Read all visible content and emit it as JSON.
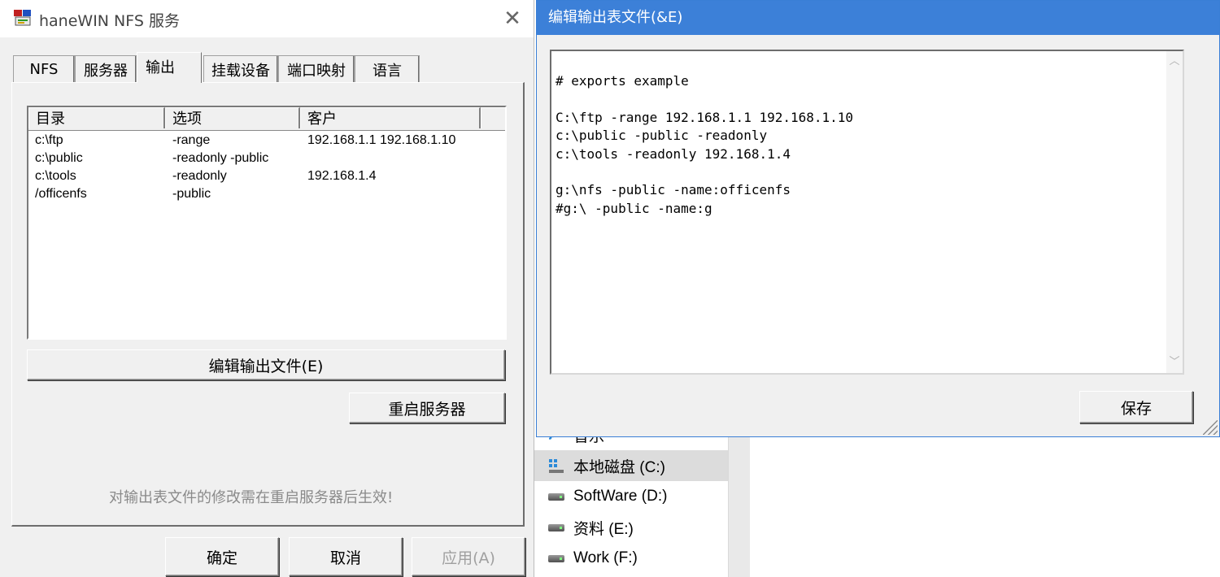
{
  "nfs_dialog": {
    "title": "haneWIN NFS 服务",
    "tabs": [
      "NFS",
      "服务器",
      "输出",
      "挂载设备",
      "端口映射",
      "语言"
    ],
    "active_tab": "输出",
    "exports_list": {
      "columns": [
        "目录",
        "选项",
        "客户"
      ],
      "rows": [
        {
          "dir": "c:\\ftp",
          "options": "-range",
          "clients": "192.168.1.1 192.168.1.10"
        },
        {
          "dir": "c:\\public",
          "options": "-readonly -public",
          "clients": ""
        },
        {
          "dir": "c:\\tools",
          "options": "-readonly",
          "clients": "192.168.1.4"
        },
        {
          "dir": "/officenfs",
          "options": "-public",
          "clients": ""
        }
      ]
    },
    "edit_exports_button": "编辑输出文件(E)",
    "restart_server_button": "重启服务器",
    "hint": "对输出表文件的修改需在重启服务器后生效!",
    "ok_button": "确定",
    "cancel_button": "取消",
    "apply_button": "应用(A)"
  },
  "edit_dialog": {
    "title": "编辑输出表文件(&E)",
    "content": "# exports example\n\nC:\\ftp -range 192.168.1.1 192.168.1.10\nc:\\public -public -readonly\nc:\\tools -readonly 192.168.1.4\n\ng:\\nfs -public -name:officenfs\n#g:\\ -public -name:g",
    "save_button": "保存"
  },
  "explorer": {
    "nav_items": [
      {
        "label": "音乐",
        "icon": "music-icon"
      },
      {
        "label": "本地磁盘 (C:)",
        "icon": "windows-drive-icon",
        "selected": true
      },
      {
        "label": "SoftWare (D:)",
        "icon": "drive-icon"
      },
      {
        "label": "资料 (E:)",
        "icon": "drive-icon"
      },
      {
        "label": "Work (F:)",
        "icon": "drive-icon"
      }
    ]
  },
  "colors": {
    "title_active": "#3c80d8",
    "dialog_bg": "#f0f0f0",
    "hint_text": "#8a8a8a"
  }
}
